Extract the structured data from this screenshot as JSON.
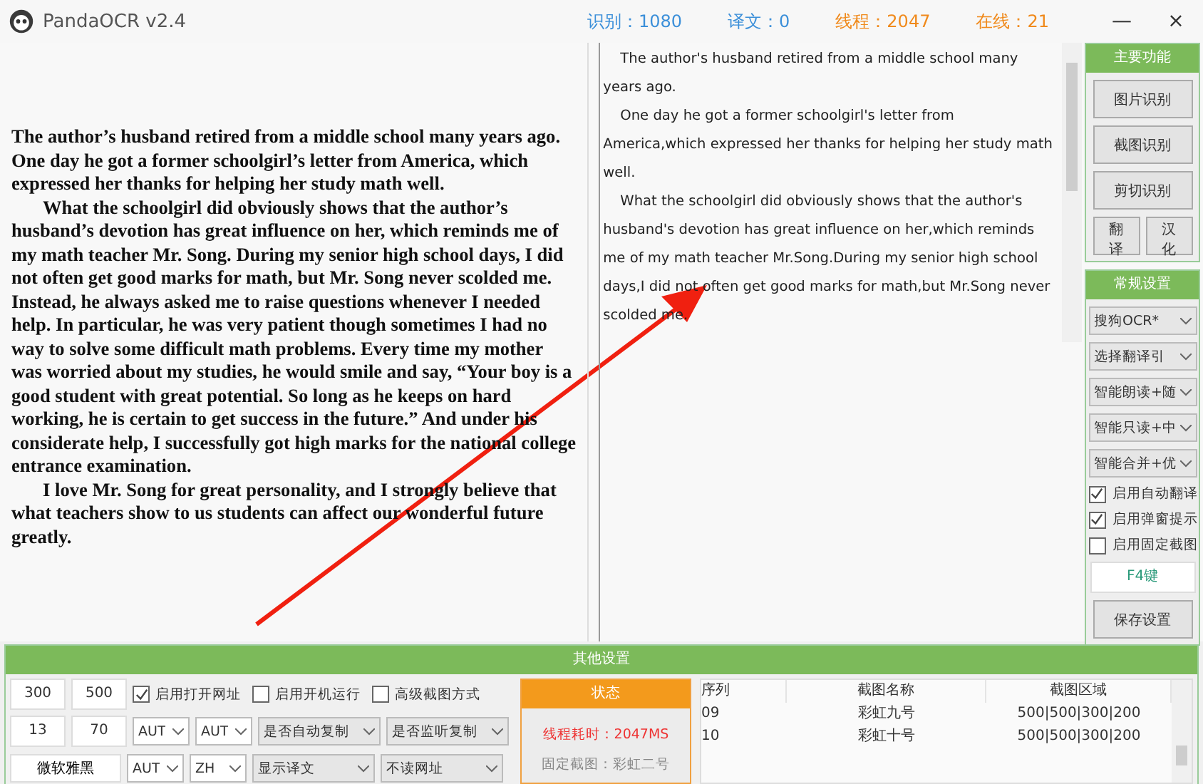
{
  "window": {
    "title": "PandaOCR v2.4",
    "controls": [
      "—",
      "×"
    ]
  },
  "stats": [
    {
      "text": "识别：1080",
      "kind": "count"
    },
    {
      "text": "译文：0",
      "kind": "count"
    },
    {
      "text": "线程：2047",
      "kind": "thread"
    },
    {
      "text": "在线：21",
      "kind": "thread"
    }
  ],
  "document": {
    "paragraphs": [
      "The author’s husband retired from a middle school many years ago. One day he got a former schoolgirl’s letter from America, which expressed her thanks for helping her study math well.",
      "What the schoolgirl did obviously shows that the author’s husband’s devotion has great influence on her, which reminds me of my math teacher Mr. Song. During my senior high school days, I did not often get good marks for math, but Mr. Song never scolded me. Instead, he always asked me to raise questions whenever I needed help. In particular, he was very patient though sometimes I had no way to solve some difficult math problems. Every time my mother was worried about my studies, he would smile and say, “Your boy is a good student with great potential. So long as he keeps on hard working, he is certain to get success in the future.” And under his considerate help, I successfully got high marks for the national college entrance examination.",
      "I love Mr. Song for great personality, and I strongly believe that what teachers show to us students can affect our wonderful future greatly."
    ]
  },
  "result": {
    "paragraphs": [
      "The author's husband retired from a middle school many years ago.",
      "One day he got a former schoolgirl's letter from America,which expressed her thanks for helping her study math well.",
      "What the schoolgirl did obviously shows that the author's husband's devotion has great influence on her,which reminds me of my math teacher Mr.Song.During my senior high school days,I did not often get good marks for math,but Mr.Song never scolded me."
    ]
  },
  "main_functions": {
    "title": "主要功能",
    "buttons": [
      "图片识别",
      "截图识别",
      "剪切识别"
    ],
    "small_buttons": [
      "翻译",
      "汉化"
    ]
  },
  "general_settings": {
    "title": "常规设置",
    "dropdowns": [
      "搜狗OCR*",
      "选择翻译引",
      "智能朗读+随",
      "智能只读+中",
      "智能合并+优"
    ],
    "checkboxes": [
      {
        "label": "启用自动翻译",
        "checked": true
      },
      {
        "label": "启用弹窗提示",
        "checked": true
      },
      {
        "label": "启用固定截图",
        "checked": false
      }
    ],
    "hotkey": "F4键",
    "save": "保存设置"
  },
  "other_settings": {
    "title": "其他设置",
    "fields": [
      "300",
      "500",
      "13",
      "70"
    ],
    "font": "微软雅黑",
    "checkboxes": [
      {
        "label": "启用打开网址",
        "checked": true
      },
      {
        "label": "启用开机运行",
        "checked": false
      },
      {
        "label": "高级截图方式",
        "checked": false
      }
    ],
    "lang_dropdowns": [
      "AUT",
      "AUT",
      "AUT",
      "ZH"
    ],
    "option_dropdowns": [
      "是否自动复制",
      "是否监听复制",
      "显示译文",
      "不读网址"
    ]
  },
  "status": {
    "title": "状态",
    "time": "线程耗时：2047MS",
    "fixed": "固定截图：彩虹二号"
  },
  "table": {
    "columns": [
      "序列",
      "截图名称",
      "截图区域"
    ],
    "rows": [
      [
        "09",
        "彩虹九号",
        "500|500|300|200"
      ],
      [
        "10",
        "彩虹十号",
        "500|500|300|200"
      ]
    ]
  }
}
